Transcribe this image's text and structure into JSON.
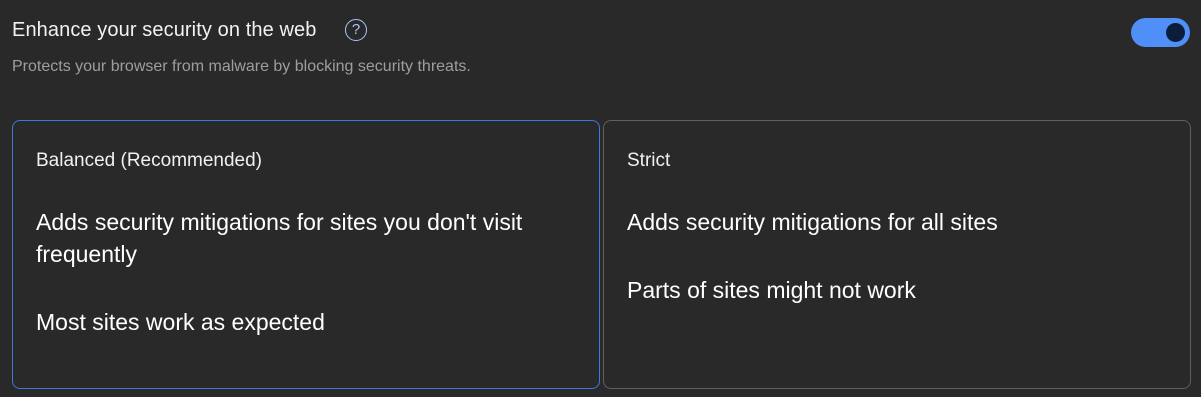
{
  "header": {
    "title": "Enhance your security on the web",
    "help_icon": "help-circle-icon",
    "subtitle": "Protects your browser from malware by blocking security threats.",
    "toggle_on": true
  },
  "options": [
    {
      "title": "Balanced (Recommended)",
      "selected": true,
      "lines": [
        "Adds security mitigations for sites you don't visit frequently",
        "Most sites work as expected"
      ]
    },
    {
      "title": "Strict",
      "selected": false,
      "lines": [
        "Adds security mitigations for all sites",
        "Parts of sites might not work"
      ]
    }
  ],
  "colors": {
    "background": "#292929",
    "accent": "#4f8ff7",
    "selected_border": "#3f78d8",
    "unselected_border": "#5f5f5f"
  }
}
